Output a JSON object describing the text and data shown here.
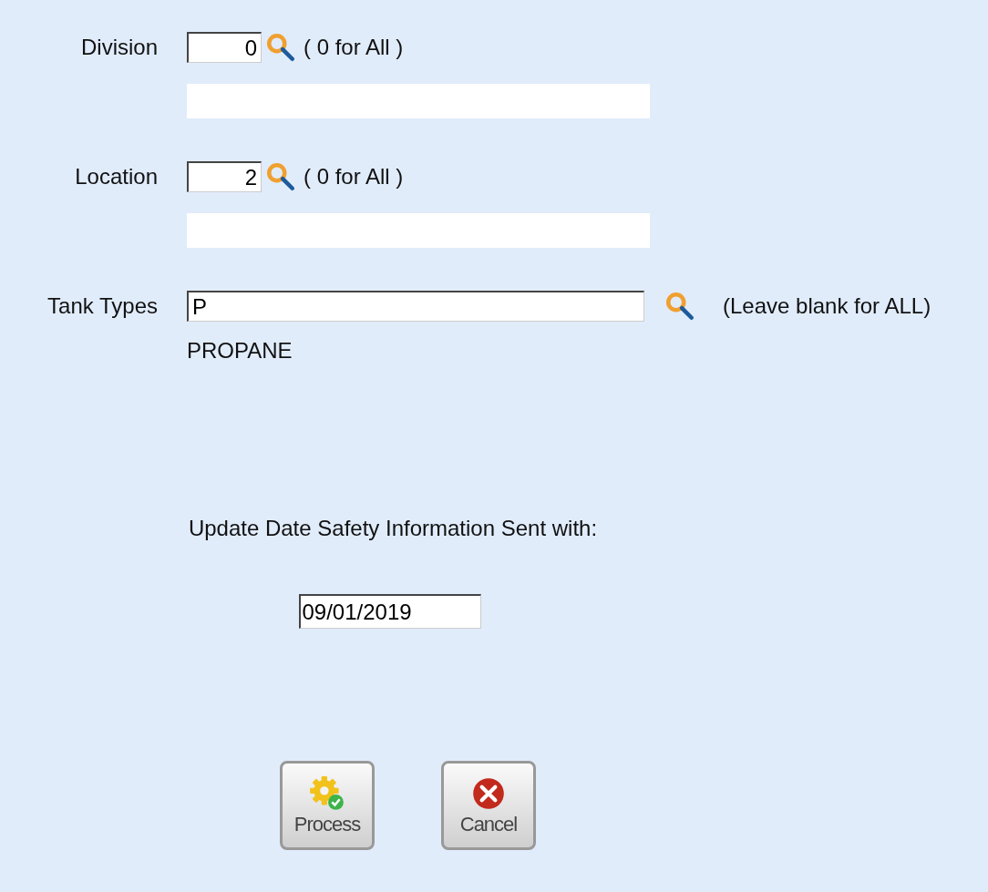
{
  "filters": [
    {
      "label": "Division",
      "value": "0",
      "hint": "( 0 for All )",
      "kind": "number"
    },
    {
      "label": "Location",
      "value": "2",
      "hint": "( 0 for All )",
      "kind": "number"
    },
    {
      "label": "Tank Types",
      "value": "P",
      "hint": "(Leave blank for ALL)",
      "kind": "text",
      "description": "PROPANE"
    }
  ],
  "update": {
    "label": "Update Date Safety Information Sent with:",
    "date": "09/01/2019"
  },
  "buttons": [
    {
      "label": "Process",
      "kind": "process"
    },
    {
      "label": "Cancel",
      "kind": "cancel"
    }
  ]
}
